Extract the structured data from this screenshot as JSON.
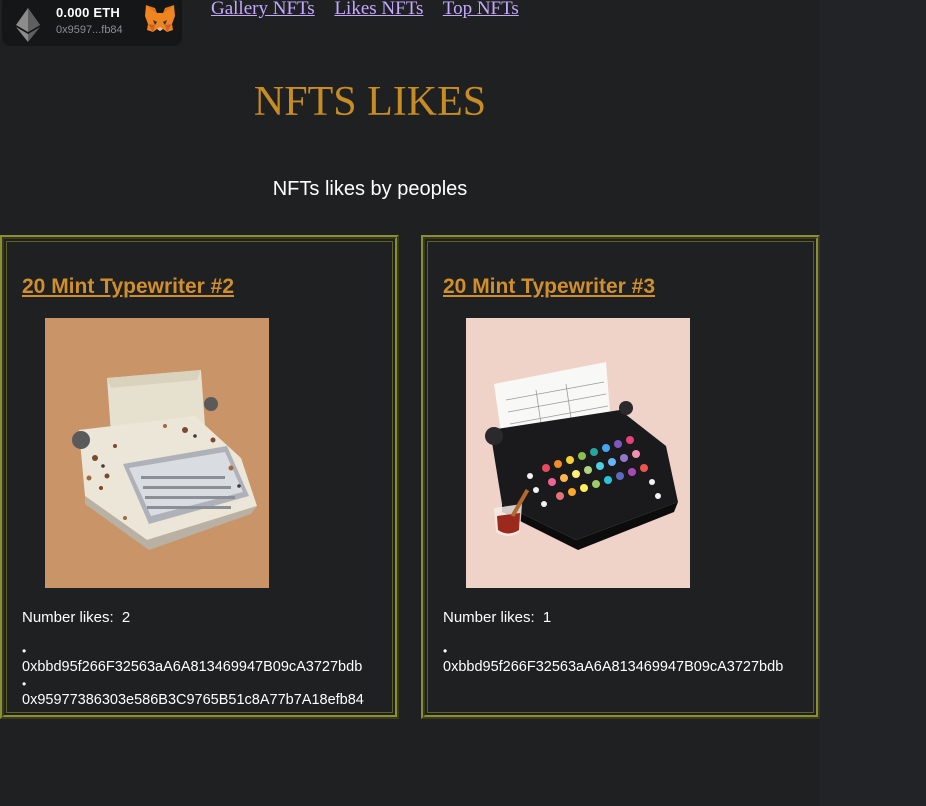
{
  "wallet": {
    "balance": "0.000 ETH",
    "address": "0x9597...fb84",
    "currency_icon": "ethereum-icon",
    "provider_icon": "metamask-fox-icon"
  },
  "nav": {
    "links": [
      {
        "label": "Gallery NFTs"
      },
      {
        "label": "Likes NFTs"
      },
      {
        "label": "Top NFTs"
      }
    ]
  },
  "page": {
    "title": "NFTS LIKES",
    "subtitle": "NFTs likes by peoples"
  },
  "colors": {
    "background": "#1f2022",
    "title": "#c78c23",
    "card_title": "#d08f2b",
    "card_border": "#8a8e34",
    "link": "#c6a9ff"
  },
  "cards": [
    {
      "title": "20 Mint Typewriter #2",
      "likes_label": "Number likes:",
      "likes_count": "2",
      "likers": [
        "0xbbd95f266F32563aA6A813469947B09cA3727bdb",
        "0x95977386303e586B3C9765B51c8A77b7A18efb84"
      ]
    },
    {
      "title": "20 Mint Typewriter #3",
      "likes_label": "Number likes:",
      "likes_count": "1",
      "likers": [
        "0xbbd95f266F32563aA6A813469947B09cA3727bdb"
      ]
    }
  ]
}
